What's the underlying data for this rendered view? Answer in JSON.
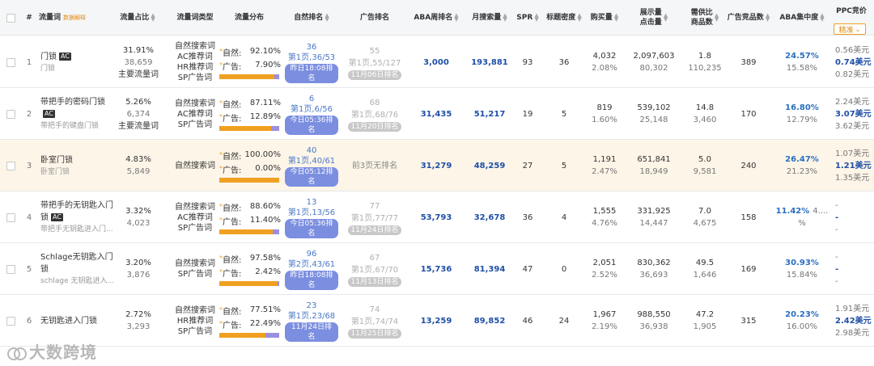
{
  "headers": {
    "num": "#",
    "kw": "流量词",
    "kw_hint": "数据解释",
    "share": "流量占比",
    "type": "流量词类型",
    "dist": "流量分布",
    "nat": "自然排名",
    "ad": "广告排名",
    "aba": "ABA周排名",
    "search": "月搜索量",
    "spr": "SPR",
    "density": "标题密度",
    "buy": "购买量",
    "imp1": "展示量",
    "imp2": "点击量",
    "sd1": "需供比",
    "sd2": "商品数",
    "adp": "广告竞品数",
    "abac": "ABA集中度",
    "ppc": "PPC竞价",
    "ppc_sel": "精准"
  },
  "rows": [
    {
      "n": "1",
      "kw": "门锁",
      "ac": "AC",
      "sub": "门锁",
      "share": "31.91%",
      "share2": "38,659",
      "share3": "主要流量词",
      "types": [
        "自然搜索词",
        "AC推荐词",
        "HR推荐词",
        "SP广告词"
      ],
      "nat_l": "自然:",
      "nat_v": "92.10%",
      "ad_l": "广告:",
      "ad_v": "7.90%",
      "nat_pct": 92.1,
      "nr1": "36",
      "nr2": "第1页,36/53",
      "nr3": "昨日18:08排名",
      "ar1": "55",
      "ar2": "第1页,55/127",
      "ar3": "11月06日排名",
      "aba": "3,000",
      "search": "193,881",
      "spr": "93",
      "den": "36",
      "buy": "4,032",
      "buy2": "2.08%",
      "imp": "2,097,603",
      "clk": "80,302",
      "sd": "1.8",
      "sd2": "110,235",
      "adp": "389",
      "c1": "24.57%",
      "c2": "15.58%",
      "p1": "0.56美元",
      "p2": "0.74美元",
      "p3": "0.82美元"
    },
    {
      "n": "2",
      "kw": "带把手的密码门锁",
      "ac": "AC",
      "sub": "带把手的键盘门锁",
      "share": "5.26%",
      "share2": "6,374",
      "share3": "主要流量词",
      "types": [
        "自然搜索词",
        "AC推荐词",
        "SP广告词"
      ],
      "nat_l": "自然:",
      "nat_v": "87.11%",
      "ad_l": "广告:",
      "ad_v": "12.89%",
      "nat_pct": 87.11,
      "nr1": "6",
      "nr2": "第1页,6/56",
      "nr3": "今日05:36排名",
      "ar1": "68",
      "ar2": "第1页,68/76",
      "ar3": "11月20日排名",
      "aba": "31,435",
      "search": "51,217",
      "spr": "19",
      "den": "5",
      "buy": "819",
      "buy2": "1.60%",
      "imp": "539,102",
      "clk": "25,148",
      "sd": "14.8",
      "sd2": "3,460",
      "adp": "170",
      "c1": "16.80%",
      "c2": "12.79%",
      "p1": "2.24美元",
      "p2": "3.07美元",
      "p3": "3.62美元"
    },
    {
      "n": "3",
      "kw": "卧室门锁",
      "ac": "",
      "sub": "卧室门锁",
      "share": "4.83%",
      "share2": "5,849",
      "share3": "",
      "types": [
        "自然搜索词"
      ],
      "nat_l": "自然:",
      "nat_v": "100.00%",
      "ad_l": "广告:",
      "ad_v": "0.00%",
      "nat_pct": 100,
      "nr1": "40",
      "nr2": "第1页,40/61",
      "nr3": "今日05:12排名",
      "ar1": "",
      "ar2": "前3页无排名",
      "ar3": "",
      "aba": "31,279",
      "search": "48,259",
      "spr": "27",
      "den": "5",
      "buy": "1,191",
      "buy2": "2.47%",
      "imp": "651,841",
      "clk": "18,949",
      "sd": "5.0",
      "sd2": "9,581",
      "adp": "240",
      "c1": "26.47%",
      "c2": "21.23%",
      "p1": "1.07美元",
      "p2": "1.21美元",
      "p3": "1.35美元"
    },
    {
      "n": "4",
      "kw": "带把手的无钥匙入门锁",
      "ac": "AC",
      "sub": "带把手无钥匙进入门...",
      "share": "3.32%",
      "share2": "4,023",
      "share3": "",
      "types": [
        "自然搜索词",
        "AC推荐词",
        "SP广告词"
      ],
      "nat_l": "自然:",
      "nat_v": "88.60%",
      "ad_l": "广告:",
      "ad_v": "11.40%",
      "nat_pct": 88.6,
      "nr1": "13",
      "nr2": "第1页,13/56",
      "nr3": "今日05:36排名",
      "ar1": "77",
      "ar2": "第1页,77/77",
      "ar3": "11月24日排名",
      "aba": "53,793",
      "search": "32,678",
      "spr": "36",
      "den": "4",
      "buy": "1,555",
      "buy2": "4.76%",
      "imp": "331,925",
      "clk": "14,447",
      "sd": "7.0",
      "sd2": "4,675",
      "adp": "158",
      "c1": "11.42%",
      "c1b": "4....",
      "c2": "%",
      "p1": "-",
      "p2": "-",
      "p3": "-"
    },
    {
      "n": "5",
      "kw": "Schlage无钥匙入门锁",
      "ac": "",
      "sub": "schlage 无钥匙进入...",
      "share": "3.20%",
      "share2": "3,876",
      "share3": "",
      "types": [
        "自然搜索词",
        "SP广告词"
      ],
      "nat_l": "自然:",
      "nat_v": "97.58%",
      "ad_l": "广告:",
      "ad_v": "2.42%",
      "nat_pct": 97.58,
      "nr1": "96",
      "nr2": "第2页,43/61",
      "nr3": "昨日18:08排名",
      "ar1": "67",
      "ar2": "第1页,67/70",
      "ar3": "11月13日排名",
      "aba": "15,736",
      "search": "81,394",
      "spr": "47",
      "den": "0",
      "buy": "2,051",
      "buy2": "2.52%",
      "imp": "830,362",
      "clk": "36,693",
      "sd": "49.5",
      "sd2": "1,646",
      "adp": "169",
      "c1": "30.93%",
      "c2": "15.84%",
      "p1": "-",
      "p2": "-",
      "p3": "-"
    },
    {
      "n": "6",
      "kw": "无钥匙进入门锁",
      "ac": "",
      "sub": "",
      "share": "2.72%",
      "share2": "3,293",
      "share3": "",
      "types": [
        "自然搜索词",
        "HR推荐词",
        "SP广告词"
      ],
      "nat_l": "自然:",
      "nat_v": "77.51%",
      "ad_l": "广告:",
      "ad_v": "22.49%",
      "nat_pct": 77.51,
      "nr1": "23",
      "nr2": "第1页,23/68",
      "nr3": "11月24日排名",
      "ar1": "74",
      "ar2": "第1页,74/74",
      "ar3": "11月25日排名",
      "aba": "13,259",
      "search": "89,852",
      "spr": "46",
      "den": "24",
      "buy": "1,967",
      "buy2": "2.19%",
      "imp": "988,550",
      "clk": "36,938",
      "sd": "47.2",
      "sd2": "1,905",
      "adp": "315",
      "c1": "20.23%",
      "c2": "16.00%",
      "p1": "1.91美元",
      "p2": "2.42美元",
      "p3": "2.98美元"
    }
  ],
  "watermark": "大数跨境"
}
